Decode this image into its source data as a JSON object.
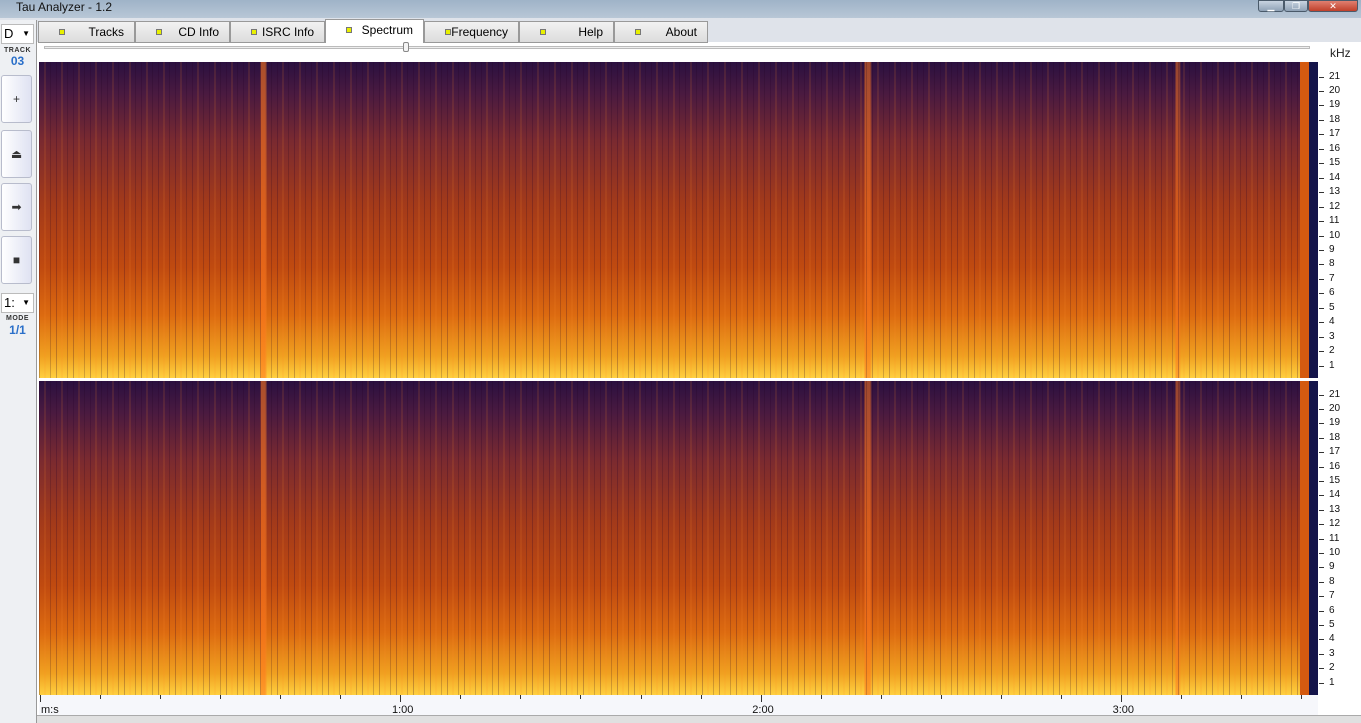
{
  "window": {
    "title": "Tau Analyzer - 1.2",
    "controls": [
      "minimize",
      "restore",
      "close"
    ]
  },
  "sidebar": {
    "drive": "D",
    "track_label": "TRACK",
    "track_value": "03",
    "buttons": [
      {
        "name": "zoom-in",
        "glyph": "+"
      },
      {
        "name": "eject",
        "glyph": "⏏"
      },
      {
        "name": "play",
        "glyph": "➡"
      },
      {
        "name": "stop",
        "glyph": "■"
      }
    ],
    "mode_select": "1:",
    "mode_label": "MODE",
    "mode_value": "1/1"
  },
  "tabs": [
    {
      "label": "Tracks"
    },
    {
      "label": "CD Info"
    },
    {
      "label": "ISRC Info"
    },
    {
      "label": "Spectrum",
      "active": true
    },
    {
      "label": "Frequency"
    },
    {
      "label": "Help"
    },
    {
      "label": "About"
    }
  ],
  "spectrum": {
    "freq_unit": "kHz",
    "freq_ticks": [
      "1",
      "2",
      "3",
      "4",
      "5",
      "6",
      "7",
      "8",
      "9",
      "10",
      "11",
      "12",
      "13",
      "14",
      "15",
      "16",
      "17",
      "18",
      "19",
      "20",
      "21"
    ],
    "time_unit": "m:s",
    "time_labels": [
      "1:00",
      "2:00",
      "3:00"
    ],
    "channels": 2,
    "colormap": [
      "#2a1040",
      "#7a2a30",
      "#c04a10",
      "#f0a020",
      "#ffd040"
    ]
  }
}
